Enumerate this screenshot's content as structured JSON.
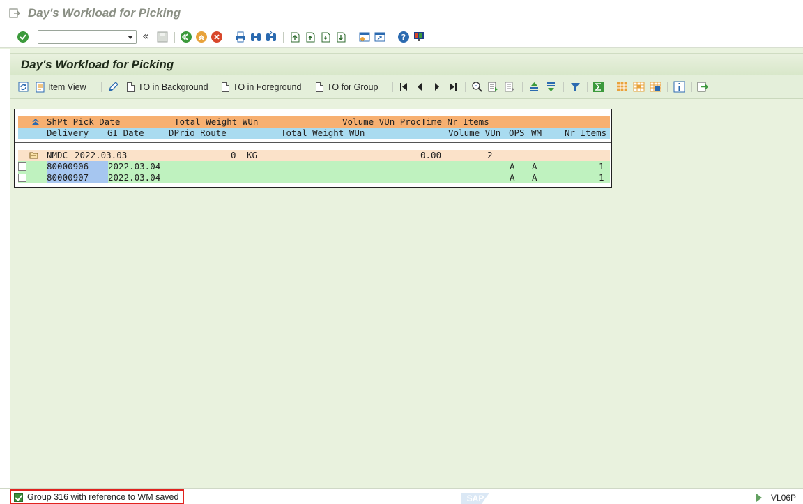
{
  "window": {
    "title": "Day's Workload for Picking"
  },
  "screen": {
    "title": "Day's Workload for Picking"
  },
  "toolbar": {
    "command_field_value": "",
    "colors": {
      "green": "#3c9a3c",
      "orange": "#e8a23a",
      "red": "#d8472b",
      "blue": "#2b6ab0"
    }
  },
  "app_toolbar": {
    "item_view": "Item View",
    "to_background": "TO in Background",
    "to_foreground": "TO in Foreground",
    "to_group": "TO for Group"
  },
  "list": {
    "header1": {
      "shpt_pick_date": "ShPt Pick Date",
      "total_weight_wun": "Total Weight WUn",
      "volume_vun_proctime_items": "Volume VUn ProcTime Nr Items"
    },
    "header2": {
      "delivery": "Delivery",
      "gi_date": "GI Date",
      "dprio_route": "DPrio Route",
      "total_weight_wun": "Total Weight WUn",
      "volume_vun": "Volume VUn",
      "ops": "OPS",
      "wm": "WM",
      "nr_items": "Nr Items"
    },
    "group": {
      "shpt": "NMDC",
      "pick_date": "2022.03.03",
      "weight": "0",
      "wun": "KG",
      "volume": "0.00",
      "items": "2"
    },
    "rows": [
      {
        "delivery": "80000906",
        "gi_date": "2022.03.04",
        "ops": "A",
        "wm": "A",
        "nr_items": "1"
      },
      {
        "delivery": "80000907",
        "gi_date": "2022.03.04",
        "ops": "A",
        "wm": "A",
        "nr_items": "1"
      }
    ]
  },
  "status": {
    "message": "Group 316 with reference to WM saved",
    "sap_logo": "SAP",
    "transaction": "VL06P"
  }
}
